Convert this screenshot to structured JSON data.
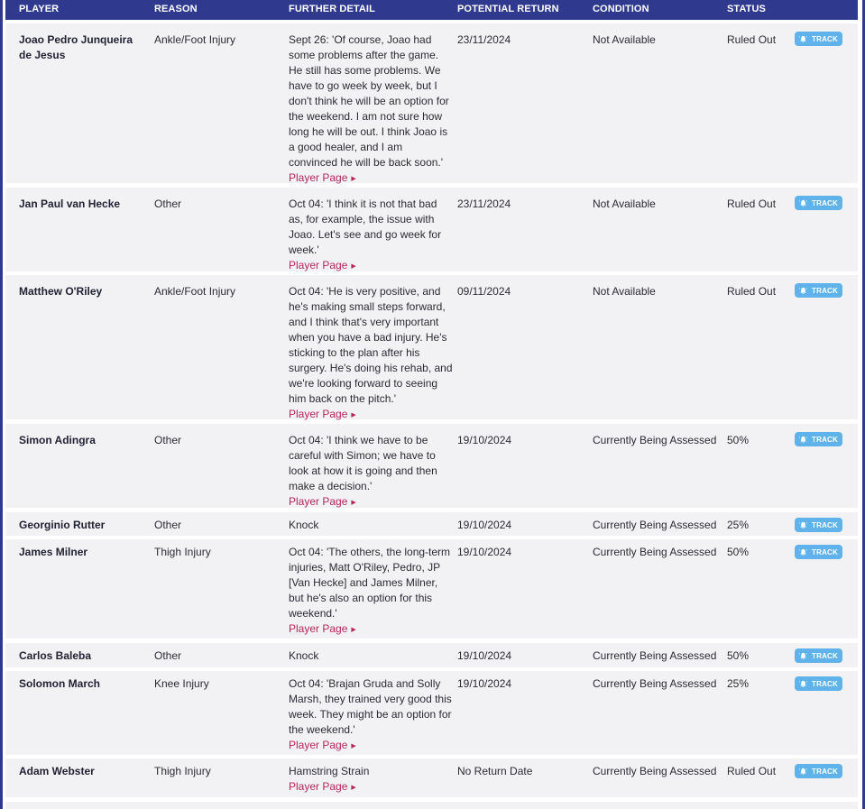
{
  "header": {
    "player": "PLAYER",
    "reason": "REASON",
    "detail": "FURTHER DETAIL",
    "return": "POTENTIAL RETURN",
    "condition": "CONDITION",
    "status": "STATUS"
  },
  "colors": {
    "header_bg": "#2f3a8f",
    "row_bg": "#f2f2f5",
    "link": "#b3275a",
    "track_button": "#5fb3ea"
  },
  "track_label": "TRACK",
  "rows": [
    {
      "player": "Joao Pedro Junqueira de Jesus",
      "reason": "Ankle/Foot Injury",
      "detail": "Sept 26: 'Of course, Joao had some problems after the game. He still has some problems. We have to go week by week, but I don't think he will be an option for the weekend. I am not sure how long he will be out. I think Joao is a good healer, and I am convinced he will be back soon.'",
      "link": "Player Page",
      "return": "23/11/2024",
      "condition": "Not Available",
      "status": "Ruled Out"
    },
    {
      "player": "Jan Paul van Hecke",
      "reason": "Other",
      "detail": "Oct 04: 'I think it is not that bad as, for example, the issue with Joao. Let's see and go week for week.'",
      "link": "Player Page",
      "return": "23/11/2024",
      "condition": "Not Available",
      "status": "Ruled Out"
    },
    {
      "player": "Matthew O'Riley",
      "reason": "Ankle/Foot Injury",
      "detail": "Oct 04: 'He is very positive, and he's making small steps forward, and I think that's very important when you have a bad injury. He's sticking to the plan after his surgery. He's doing his rehab, and we're looking forward to seeing him back on the pitch.'",
      "link": "Player Page",
      "return": "09/11/2024",
      "condition": "Not Available",
      "status": "Ruled Out"
    },
    {
      "player": "Simon Adingra",
      "reason": "Other",
      "detail": "Oct 04: 'I think we have to be careful with Simon; we have to look at how it is going and then make a decision.'",
      "link": "Player Page",
      "return": "19/10/2024",
      "condition": "Currently Being Assessed",
      "status": "50%"
    },
    {
      "player": "Georginio Rutter",
      "reason": "Other",
      "detail": "Knock",
      "link": "",
      "return": "19/10/2024",
      "condition": "Currently Being Assessed",
      "status": "25%"
    },
    {
      "player": "James Milner",
      "reason": "Thigh Injury",
      "detail": "Oct 04: 'The others, the long-term injuries, Matt O'Riley, Pedro, JP [Van Hecke] and James Milner, but he's also an option for this weekend.'",
      "link": "Player Page",
      "return": "19/10/2024",
      "condition": "Currently Being Assessed",
      "status": "50%"
    },
    {
      "player": "Carlos Baleba",
      "reason": "Other",
      "detail": "Knock",
      "link": "",
      "return": "19/10/2024",
      "condition": "Currently Being Assessed",
      "status": "50%"
    },
    {
      "player": "Solomon March",
      "reason": "Knee Injury",
      "detail": "Oct 04: 'Brajan Gruda and Solly Marsh, they trained very good this week. They might be an option for the weekend.'",
      "link": "Player Page",
      "return": "19/10/2024",
      "condition": "Currently Being Assessed",
      "status": "25%"
    },
    {
      "player": "Adam Webster",
      "reason": "Thigh Injury",
      "detail": "Hamstring Strain",
      "link": "Player Page",
      "return": "No Return Date",
      "condition": "Currently Being Assessed",
      "status": "Ruled Out"
    },
    {
      "player": "",
      "reason": "",
      "detail": "",
      "link": "",
      "return": "",
      "condition": "",
      "status": ""
    }
  ]
}
